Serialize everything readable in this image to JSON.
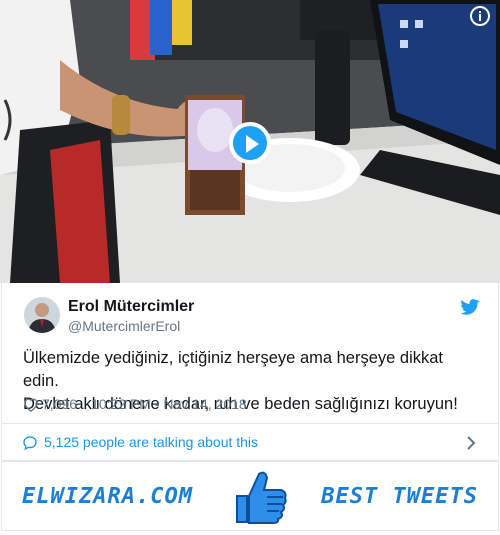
{
  "media": {
    "info_icon": "info-icon",
    "play_icon": "play-icon",
    "play_color": "#1da1f2"
  },
  "tweet": {
    "author_name": "Erol Mütercimler",
    "author_handle": "@MutercimlerErol",
    "text_line1": "Ülkemizde yediğiniz, içtiğiniz herşeye ama herşeye dikkat edin.",
    "text_line2": "Devlet aklı dönene kadar, ruh ve beden sağlığınızı koruyun!",
    "likes": "7,096",
    "timestamp": "10:22 PM - Nov 14, 2018",
    "heart_icon": "heart-icon",
    "bird_icon": "twitter-bird-icon",
    "brand_color": "#1da1f2"
  },
  "talking": {
    "label": "5,125 people are talking about this",
    "bubble_icon": "comment-bubble-icon",
    "chevron_icon": "chevron-right-icon",
    "link_color": "#1b95e0"
  },
  "banner": {
    "left_text": "ELWIZARA.COM",
    "right_text": "BEST TWEETS",
    "thumb_icon": "thumbs-up-icon",
    "color": "#1b7fd6"
  }
}
